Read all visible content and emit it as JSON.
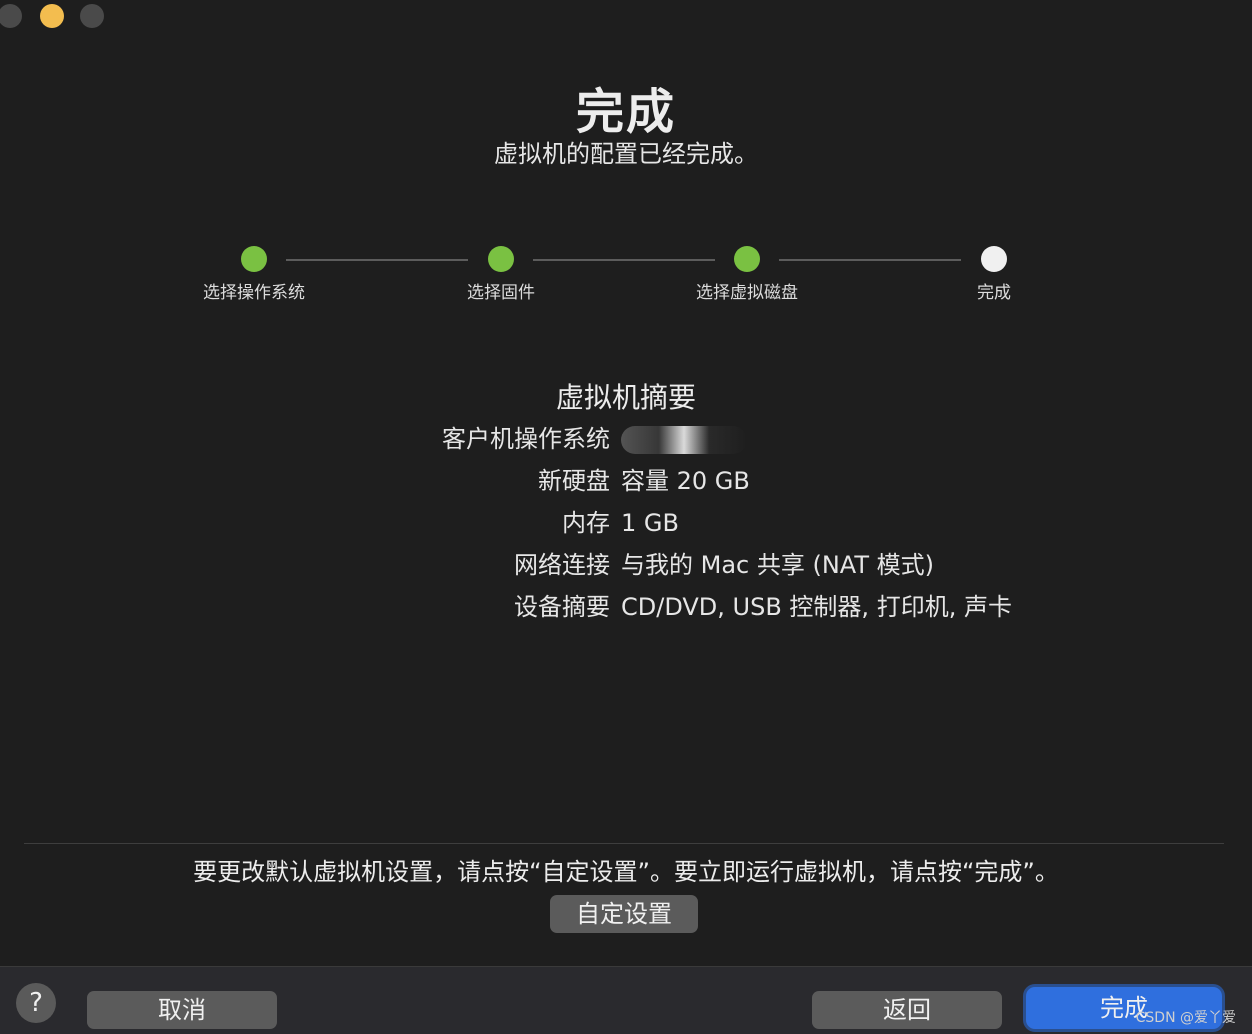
{
  "header": {
    "title": "完成",
    "subtitle": "虚拟机的配置已经完成。"
  },
  "stepper": {
    "steps": [
      {
        "label": "选择操作系统",
        "status": "done"
      },
      {
        "label": "选择固件",
        "status": "done"
      },
      {
        "label": "选择虚拟磁盘",
        "status": "done"
      },
      {
        "label": "完成",
        "status": "current"
      }
    ],
    "done_color": "#7ac142",
    "current_color": "#f0f0f0"
  },
  "summary": {
    "title": "虚拟机摘要",
    "rows": [
      {
        "key": "客户机操作系统",
        "value": ""
      },
      {
        "key": "新硬盘",
        "value": "容量 20 GB"
      },
      {
        "key": "内存",
        "value": "1 GB"
      },
      {
        "key": "网络连接",
        "value": "与我的 Mac 共享 (NAT 模式)"
      },
      {
        "key": "设备摘要",
        "value": "CD/DVD, USB 控制器, 打印机, 声卡"
      }
    ]
  },
  "footer": {
    "hint": "要更改默认虚拟机设置，请点按“自定设置”。要立即运行虚拟机，请点按“完成”。",
    "custom_button": "自定设置"
  },
  "bottom_bar": {
    "help_label": "?",
    "cancel_label": "取消",
    "back_label": "返回",
    "done_label": "完成",
    "accent_color": "#2f6fde"
  },
  "watermark": "CSDN @爱丫爱"
}
